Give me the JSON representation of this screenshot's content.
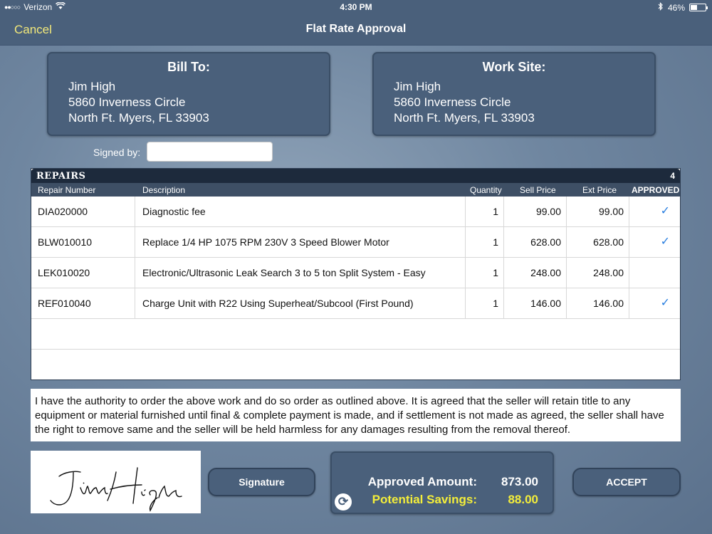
{
  "status_bar": {
    "carrier": "Verizon",
    "time": "4:30 PM",
    "battery": "46%",
    "battery_level": 0.46
  },
  "nav": {
    "cancel_label": "Cancel",
    "title": "Flat Rate Approval"
  },
  "bill_to": {
    "heading": "Bill To:",
    "name": "Jim High",
    "street": "5860 Inverness Circle",
    "city": "North Ft. Myers, FL 33903"
  },
  "work_site": {
    "heading": "Work Site:",
    "name": "Jim High",
    "street": "5860 Inverness Circle",
    "city": "North Ft. Myers, FL 33903"
  },
  "signed_by": {
    "label": "Signed by:",
    "value": ""
  },
  "repairs": {
    "title": "REPAIRS",
    "count": "4",
    "columns": {
      "number": "Repair Number",
      "description": "Description",
      "quantity": "Quantity",
      "sell": "Sell Price",
      "ext": "Ext Price",
      "approved": "APPROVED"
    },
    "rows": [
      {
        "number": "DIA020000",
        "description": "Diagnostic fee",
        "quantity": "1",
        "sell": "99.00",
        "ext": "99.00",
        "approved": "✓"
      },
      {
        "number": "BLW010010",
        "description": "Replace 1/4 HP 1075 RPM 230V 3 Speed Blower Motor",
        "quantity": "1",
        "sell": "628.00",
        "ext": "628.00",
        "approved": "✓"
      },
      {
        "number": "LEK010020",
        "description": "Electronic/Ultrasonic Leak Search 3 to 5 ton Split System - Easy",
        "quantity": "1",
        "sell": "248.00",
        "ext": "248.00",
        "approved": ""
      },
      {
        "number": "REF010040",
        "description": "Charge Unit with R22 Using Superheat/Subcool (First Pound)",
        "quantity": "1",
        "sell": "146.00",
        "ext": "146.00",
        "approved": "✓"
      }
    ]
  },
  "agreement_text": "I have the authority to order the above work and do so order as outlined above.  It is agreed that the seller will retain title to any equipment or material furnished until final & complete payment is made, and if settlement is not made as agreed, the seller shall have the right to remove same and the seller will be held harmless for any damages resulting from the removal thereof.",
  "signature": {
    "button_label": "Signature",
    "signed_name": "Jim High"
  },
  "totals": {
    "approved_label": "Approved Amount:",
    "approved_value": "873.00",
    "savings_label": "Potential Savings:",
    "savings_value": "88.00"
  },
  "accept_label": "ACCEPT",
  "colors": {
    "nav_bg": "#4a607b",
    "cancel": "#f3e97a",
    "savings": "#f4ee3a",
    "check": "#2a7fe0"
  }
}
